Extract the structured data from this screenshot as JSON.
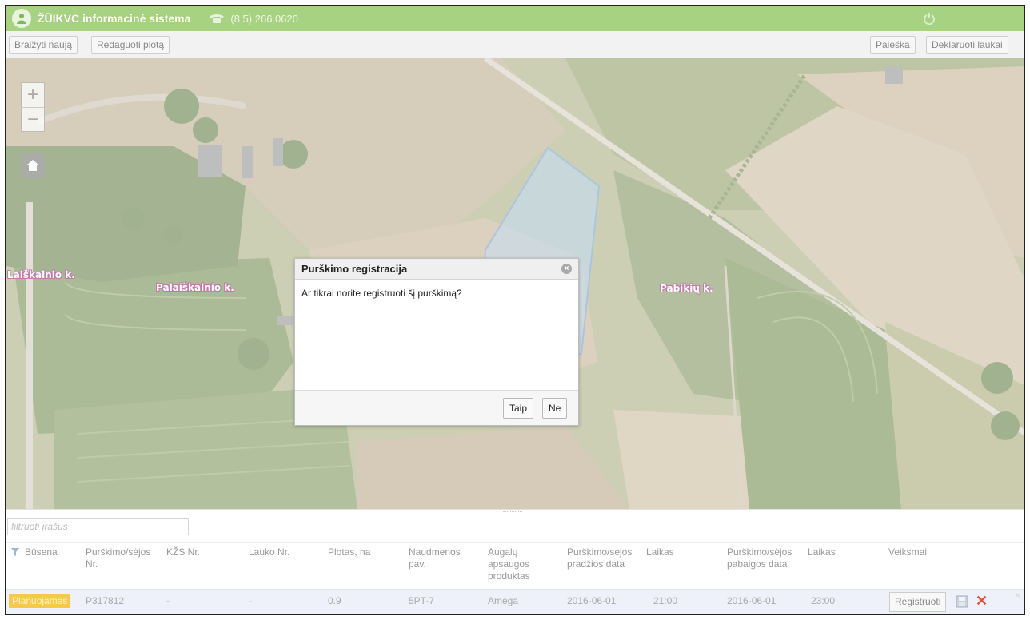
{
  "app": {
    "title": "ŽŪIKVC informacinė sistema",
    "phone": "(8 5) 266 0620"
  },
  "toolbar": {
    "draw_new": "Braižyti naują",
    "edit_area": "Redaguoti plotą",
    "search": "Paieška",
    "declared_fields": "Deklaruoti laukai"
  },
  "map": {
    "zoom_in": "+",
    "zoom_out": "−",
    "places": [
      "Laiškalnio k.",
      "Palaiškalnio k.",
      "Pabikių k."
    ]
  },
  "dialog": {
    "title": "Purškimo registracija",
    "message": "Ar tikrai norite registruoti šį purškimą?",
    "yes": "Taip",
    "no": "Ne"
  },
  "grid": {
    "filter_placeholder": "filtruoti įrašus",
    "headers": [
      "Būsena",
      "Purškimo/sėjos Nr.",
      "KŽS Nr.",
      "Lauko Nr.",
      "Plotas, ha",
      "Naudmenos pav.",
      "Augalų apsaugos produktas",
      "Purškimo/sėjos pradžios data",
      "Laikas",
      "Purškimo/sėjos pabaigos data",
      "Laikas",
      "Veiksmai"
    ],
    "rows": [
      {
        "status": "Planuojamas",
        "number": "P317812",
        "kzs": "-",
        "field": "-",
        "area": "0.9",
        "land_use": "5PT-7",
        "product": "Amega",
        "start_date": "2016-06-01",
        "start_time": "21:00",
        "end_date": "2016-06-01",
        "end_time": "23:00",
        "action": "Registruoti"
      }
    ]
  },
  "colors": {
    "topbar": "#a6d281",
    "status_planned": "#f6c94a",
    "delete": "#e0523b",
    "field_highlight": "#9dc4e8"
  }
}
